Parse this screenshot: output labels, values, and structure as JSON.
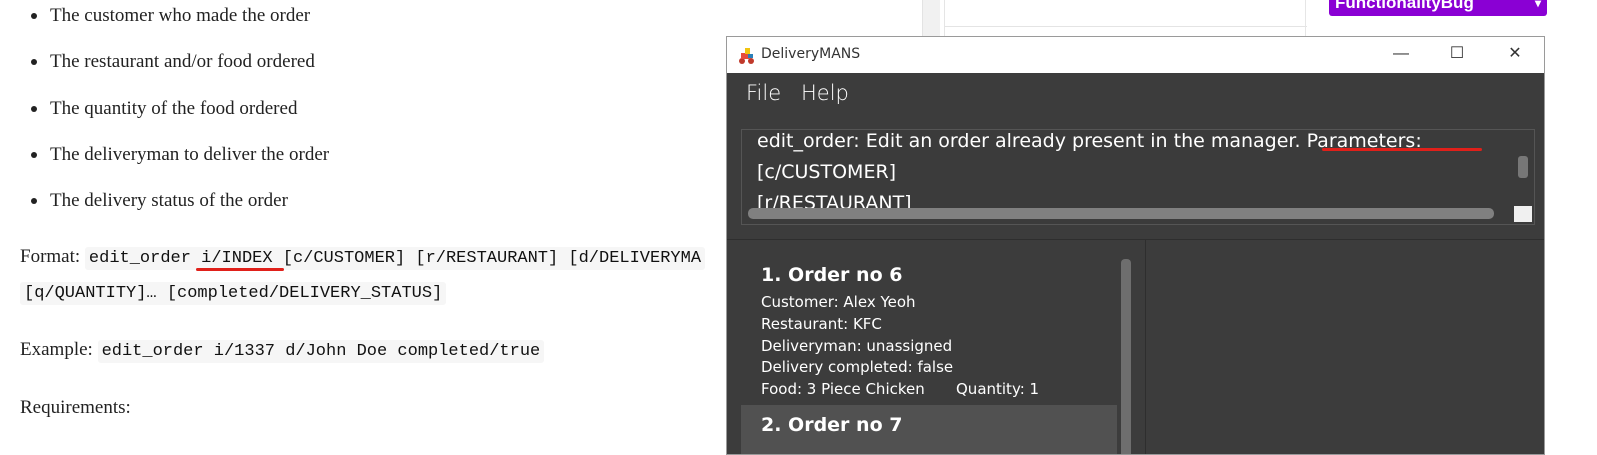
{
  "doc": {
    "bullets": [
      "The customer who made the order",
      "The restaurant and/or food ordered",
      "The quantity of the food ordered",
      "The deliveryman to deliver the order",
      "The delivery status of the order"
    ],
    "format_label": "Format:",
    "format_code_1": "edit_order i/INDEX [c/CUSTOMER] [r/RESTAURANT] [d/DELIVERYMA",
    "format_code_2": "[q/QUANTITY]… [completed/DELIVERY_STATUS]",
    "example_label": "Example:",
    "example_code": "edit_order i/1337 d/John Doe completed/true",
    "requirements_label": "Requirements:"
  },
  "issue_panel": {
    "label_badge": "FunctionalityBug"
  },
  "window": {
    "title": "DeliveryMANS",
    "minimize_glyph": "—",
    "maximize_glyph": "☐",
    "close_glyph": "✕",
    "menus": {
      "file": "File",
      "help": "Help"
    },
    "result_text": "edit_order: Edit an order already present in the manager. Parameters: [c/CUSTOMER]\n[r/RESTAURANT]\n[d/DELIVERYMAN]",
    "orders": [
      {
        "title": "1.  Order no 6",
        "customer": "Customer: Alex Yeoh",
        "restaurant": "Restaurant: KFC",
        "deliveryman": "Deliveryman: unassigned",
        "completed": "Delivery completed: false",
        "food": "Food: 3 Piece Chicken",
        "quantity": "Quantity: 1"
      },
      {
        "title": "2.  Order no 7"
      }
    ]
  },
  "colors": {
    "app_bg": "#3c3c3c",
    "selected_card": "#515151",
    "annotation_red": "#e0201a",
    "bug_label": "#8a00d4"
  }
}
